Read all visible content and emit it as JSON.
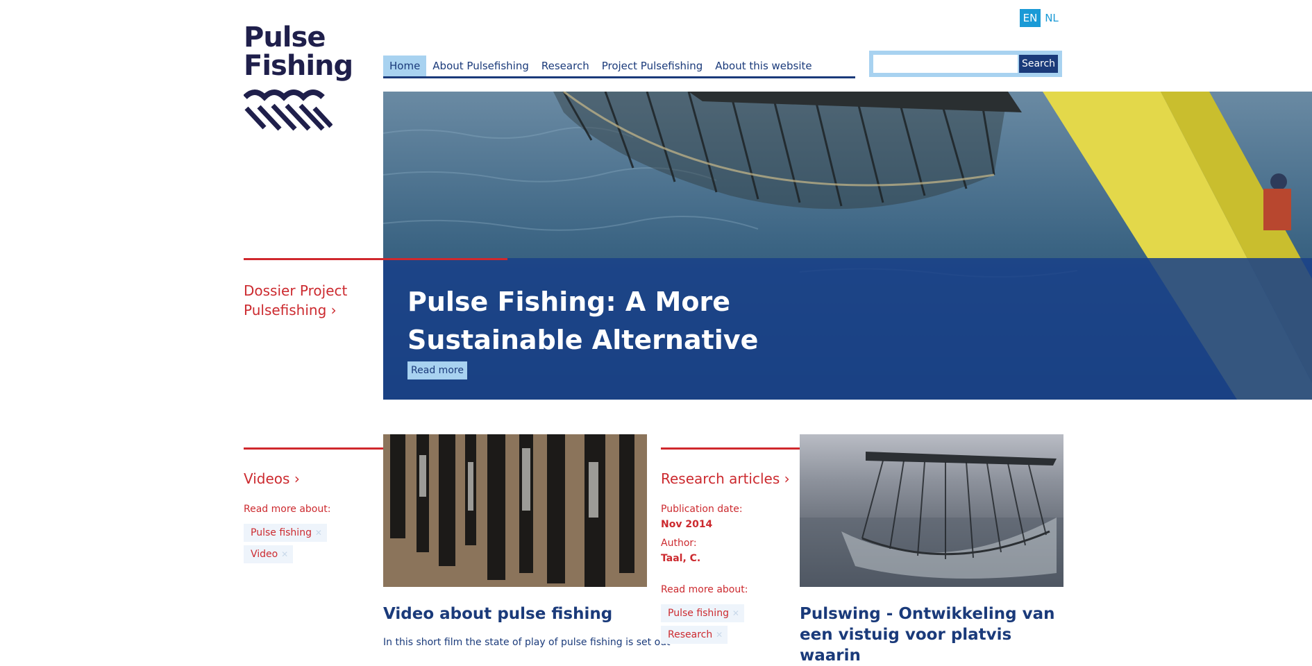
{
  "lang": {
    "en": "EN",
    "nl": "NL"
  },
  "logo": {
    "line1": "Pulse",
    "line2": "Fishing"
  },
  "nav": {
    "items": [
      {
        "label": "Home",
        "active": true
      },
      {
        "label": "About Pulsefishing"
      },
      {
        "label": "Research"
      },
      {
        "label": "Project Pulsefishing"
      },
      {
        "label": "About this website"
      }
    ]
  },
  "search": {
    "value": "",
    "button_label": "Search"
  },
  "hero": {
    "title": "Pulse Fishing: A More Sustainable Alternative",
    "button_label": "Read more",
    "side_link": "Dossier Project Pulsefishing ›"
  },
  "videos_section": {
    "heading": "Videos ›",
    "read_more_about": "Read more about:",
    "tags": [
      "Pulse fishing",
      "Video"
    ],
    "card_title": "Video about pulse fishing",
    "card_text": "In this short film the state of play of pulse fishing is set out"
  },
  "research_section": {
    "heading": "Research articles ›",
    "publication_date_label": "Publication date:",
    "publication_date": "Nov 2014",
    "author_label": "Author:",
    "author": "Taal, C.",
    "read_more_about": "Read more about:",
    "tags": [
      "Pulse fishing",
      "Research"
    ],
    "card_title": "Pulswing - Ontwikkeling van een vistuig voor platvis waarin"
  },
  "colors": {
    "navy": "#1a3a7a",
    "light_blue": "#a8d2f0",
    "red": "#cc2a2f",
    "lang_active": "#1a9ad6"
  }
}
